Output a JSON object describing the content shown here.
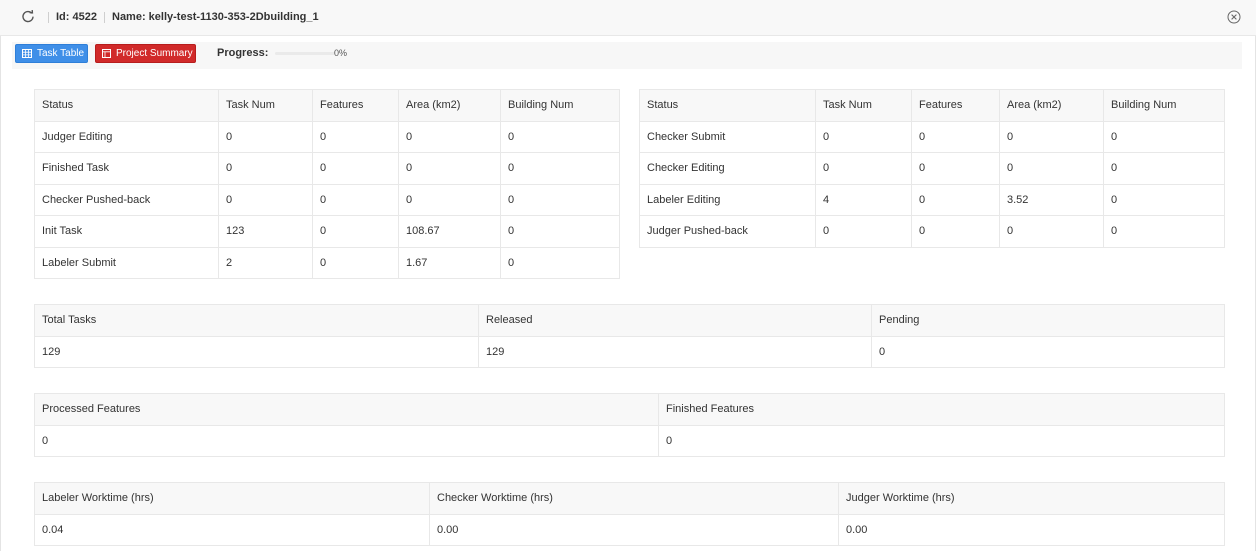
{
  "header": {
    "id_text": "Id: 4522",
    "name_text": "Name: kelly-test-1130-353-2Dbuilding_1"
  },
  "toolbar": {
    "task_table_label": "Task Table",
    "project_summary_label": "Project Summary",
    "progress_label": "Progress:",
    "progress_value": 0,
    "progress_text": "0%"
  },
  "colors": {
    "primary": "#3f8fe8",
    "danger": "#d12a2a"
  },
  "status_left": {
    "columns": [
      "Status",
      "Task Num",
      "Features",
      "Area (km2)",
      "Building Num"
    ],
    "rows": [
      [
        "Judger Editing",
        "0",
        "0",
        "0",
        "0"
      ],
      [
        "Finished Task",
        "0",
        "0",
        "0",
        "0"
      ],
      [
        "Checker Pushed-back",
        "0",
        "0",
        "0",
        "0"
      ],
      [
        "Init Task",
        "123",
        "0",
        "108.67",
        "0"
      ],
      [
        "Labeler Submit",
        "2",
        "0",
        "1.67",
        "0"
      ]
    ]
  },
  "status_right": {
    "columns": [
      "Status",
      "Task Num",
      "Features",
      "Area (km2)",
      "Building Num"
    ],
    "rows": [
      [
        "Checker Submit",
        "0",
        "0",
        "0",
        "0"
      ],
      [
        "Checker Editing",
        "0",
        "0",
        "0",
        "0"
      ],
      [
        "Labeler Editing",
        "4",
        "0",
        "3.52",
        "0"
      ],
      [
        "Judger Pushed-back",
        "0",
        "0",
        "0",
        "0"
      ]
    ]
  },
  "tasks_summary": {
    "columns": [
      "Total Tasks",
      "Released",
      "Pending"
    ],
    "values": [
      "129",
      "129",
      "0"
    ]
  },
  "features_summary": {
    "columns": [
      "Processed Features",
      "Finished Features"
    ],
    "values": [
      "0",
      "0"
    ]
  },
  "worktime_summary": {
    "columns": [
      "Labeler Worktime (hrs)",
      "Checker Worktime (hrs)",
      "Judger Worktime (hrs)"
    ],
    "values": [
      "0.04",
      "0.00",
      "0.00"
    ]
  }
}
